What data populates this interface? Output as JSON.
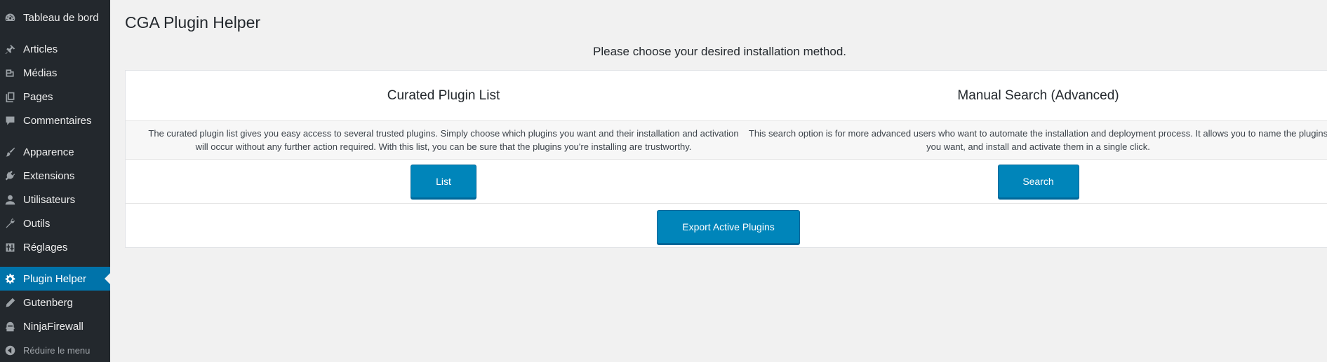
{
  "sidebar": {
    "items": [
      {
        "label": "Tableau de bord",
        "icon": "dashboard-icon"
      },
      {
        "label": "Articles",
        "icon": "pin-icon"
      },
      {
        "label": "Médias",
        "icon": "media-icon"
      },
      {
        "label": "Pages",
        "icon": "pages-icon"
      },
      {
        "label": "Commentaires",
        "icon": "comments-icon"
      },
      {
        "label": "Apparence",
        "icon": "brush-icon"
      },
      {
        "label": "Extensions",
        "icon": "plugins-icon"
      },
      {
        "label": "Utilisateurs",
        "icon": "users-icon"
      },
      {
        "label": "Outils",
        "icon": "wrench-icon"
      },
      {
        "label": "Réglages",
        "icon": "settings-icon"
      },
      {
        "label": "Plugin Helper",
        "icon": "gear-icon",
        "active": true
      },
      {
        "label": "Gutenberg",
        "icon": "pencil-icon"
      },
      {
        "label": "NinjaFirewall",
        "icon": "ninja-icon"
      }
    ],
    "collapse_label": "Réduire le menu",
    "accent_color": "#0073aa"
  },
  "page": {
    "title": "CGA Plugin Helper",
    "instruction": "Please choose your desired installation method."
  },
  "columns": [
    {
      "title": "Curated Plugin List",
      "description": "The curated plugin list gives you easy access to several trusted plugins. Simply choose which plugins you want and their installation and activation will occur without any further action required. With this list, you can be sure that the plugins you're installing are trustworthy.",
      "button_label": "List"
    },
    {
      "title": "Manual Search (Advanced)",
      "description": "This search option is for more advanced users who want to automate the installation and deployment process. It allows you to name the plugins you want, and install and activate them in a single click.",
      "button_label": "Search"
    }
  ],
  "export_button_label": "Export Active Plugins"
}
